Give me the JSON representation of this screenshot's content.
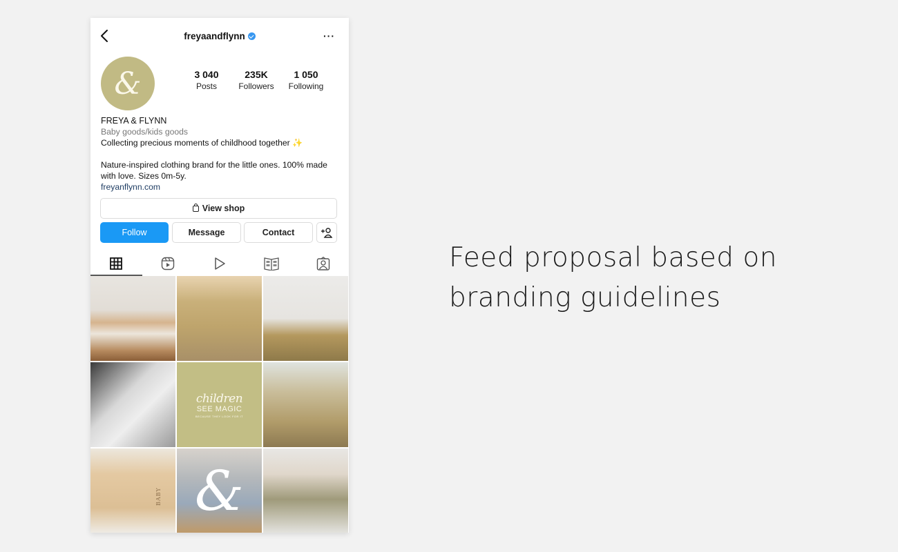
{
  "profile": {
    "username": "freyaandflynn",
    "verified": true,
    "avatar_glyph": "&",
    "stats": [
      {
        "value": "3 040",
        "label": "Posts"
      },
      {
        "value": "235K",
        "label": "Followers"
      },
      {
        "value": "1 050",
        "label": "Following"
      }
    ],
    "display_name": "FREYA & FLYNN",
    "category": "Baby goods/kids goods",
    "bio_line1": "Collecting precious moments of childhood together",
    "bio_emoji": "✨",
    "bio_line2": "Nature-inspired clothing brand for the little ones. 100% made with love. Sizes 0m-5y.",
    "website": "freyanflynn.com"
  },
  "buttons": {
    "view_shop": "View shop",
    "follow": "Follow",
    "message": "Message",
    "contact": "Contact"
  },
  "accent_color": "#1a99f5",
  "tabs": [
    "grid",
    "reels",
    "videos",
    "guides",
    "tagged"
  ],
  "grid": {
    "tiles": [
      {
        "description": "stack of knitted sweaters on wooden stool"
      },
      {
        "description": "two girls on beach dunes"
      },
      {
        "description": "laughing child in olive cardigan"
      },
      {
        "description": "black and white mother with baby"
      },
      {
        "description": "quote tile",
        "title": "children",
        "subtitle": "SEE MAGIC",
        "tagline": "BECAUSE THEY LOOK FOR IT"
      },
      {
        "description": "two toddlers in tall grass"
      },
      {
        "description": "wooden baby box with brush",
        "label": "BABY"
      },
      {
        "description": "three children at beach with ampersand logo",
        "overlay": "&"
      },
      {
        "description": "baby in olive sleepsuit"
      }
    ]
  },
  "caption": {
    "line1": "Feed proposal based on",
    "line2": "branding guidelines"
  }
}
